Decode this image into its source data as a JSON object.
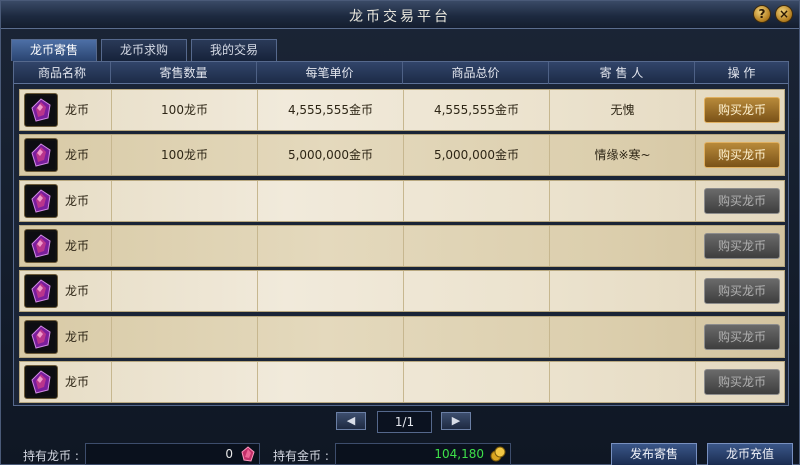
{
  "window": {
    "title": "龙币交易平台",
    "help_label": "?",
    "close_label": "×"
  },
  "tabs": [
    {
      "label": "龙币寄售",
      "active": true
    },
    {
      "label": "龙币求购",
      "active": false
    },
    {
      "label": "我的交易",
      "active": false
    }
  ],
  "table": {
    "headers": [
      "商品名称",
      "寄售数量",
      "每笔单价",
      "商品总价",
      "寄 售 人",
      "操 作"
    ],
    "rows": [
      {
        "name": "龙币",
        "quantity": "100龙币",
        "unit_price": "4,555,555金币",
        "total_price": "4,555,555金币",
        "seller": "无愧",
        "action": "购买龙币",
        "enabled": true
      },
      {
        "name": "龙币",
        "quantity": "100龙币",
        "unit_price": "5,000,000金币",
        "total_price": "5,000,000金币",
        "seller": "情缘※寒~",
        "action": "购买龙币",
        "enabled": true
      },
      {
        "name": "龙币",
        "quantity": "",
        "unit_price": "",
        "total_price": "",
        "seller": "",
        "action": "购买龙币",
        "enabled": false
      },
      {
        "name": "龙币",
        "quantity": "",
        "unit_price": "",
        "total_price": "",
        "seller": "",
        "action": "购买龙币",
        "enabled": false
      },
      {
        "name": "龙币",
        "quantity": "",
        "unit_price": "",
        "total_price": "",
        "seller": "",
        "action": "购买龙币",
        "enabled": false
      },
      {
        "name": "龙币",
        "quantity": "",
        "unit_price": "",
        "total_price": "",
        "seller": "",
        "action": "购买龙币",
        "enabled": false
      },
      {
        "name": "龙币",
        "quantity": "",
        "unit_price": "",
        "total_price": "",
        "seller": "",
        "action": "购买龙币",
        "enabled": false
      }
    ]
  },
  "pager": {
    "prev_label": "◀",
    "next_label": "▶",
    "page": "1/1"
  },
  "footer": {
    "dragon_coin_label": "持有龙币 :",
    "dragon_coin_value": "0",
    "gold_label": "持有金币 :",
    "gold_value": "104,180",
    "gold_color": "#3ee04a",
    "publish_button": "发布寄售",
    "recharge_button": "龙币充值"
  },
  "icons": {
    "item": "dragon-coin-gem-icon",
    "gold": "gold-coins-icon"
  }
}
